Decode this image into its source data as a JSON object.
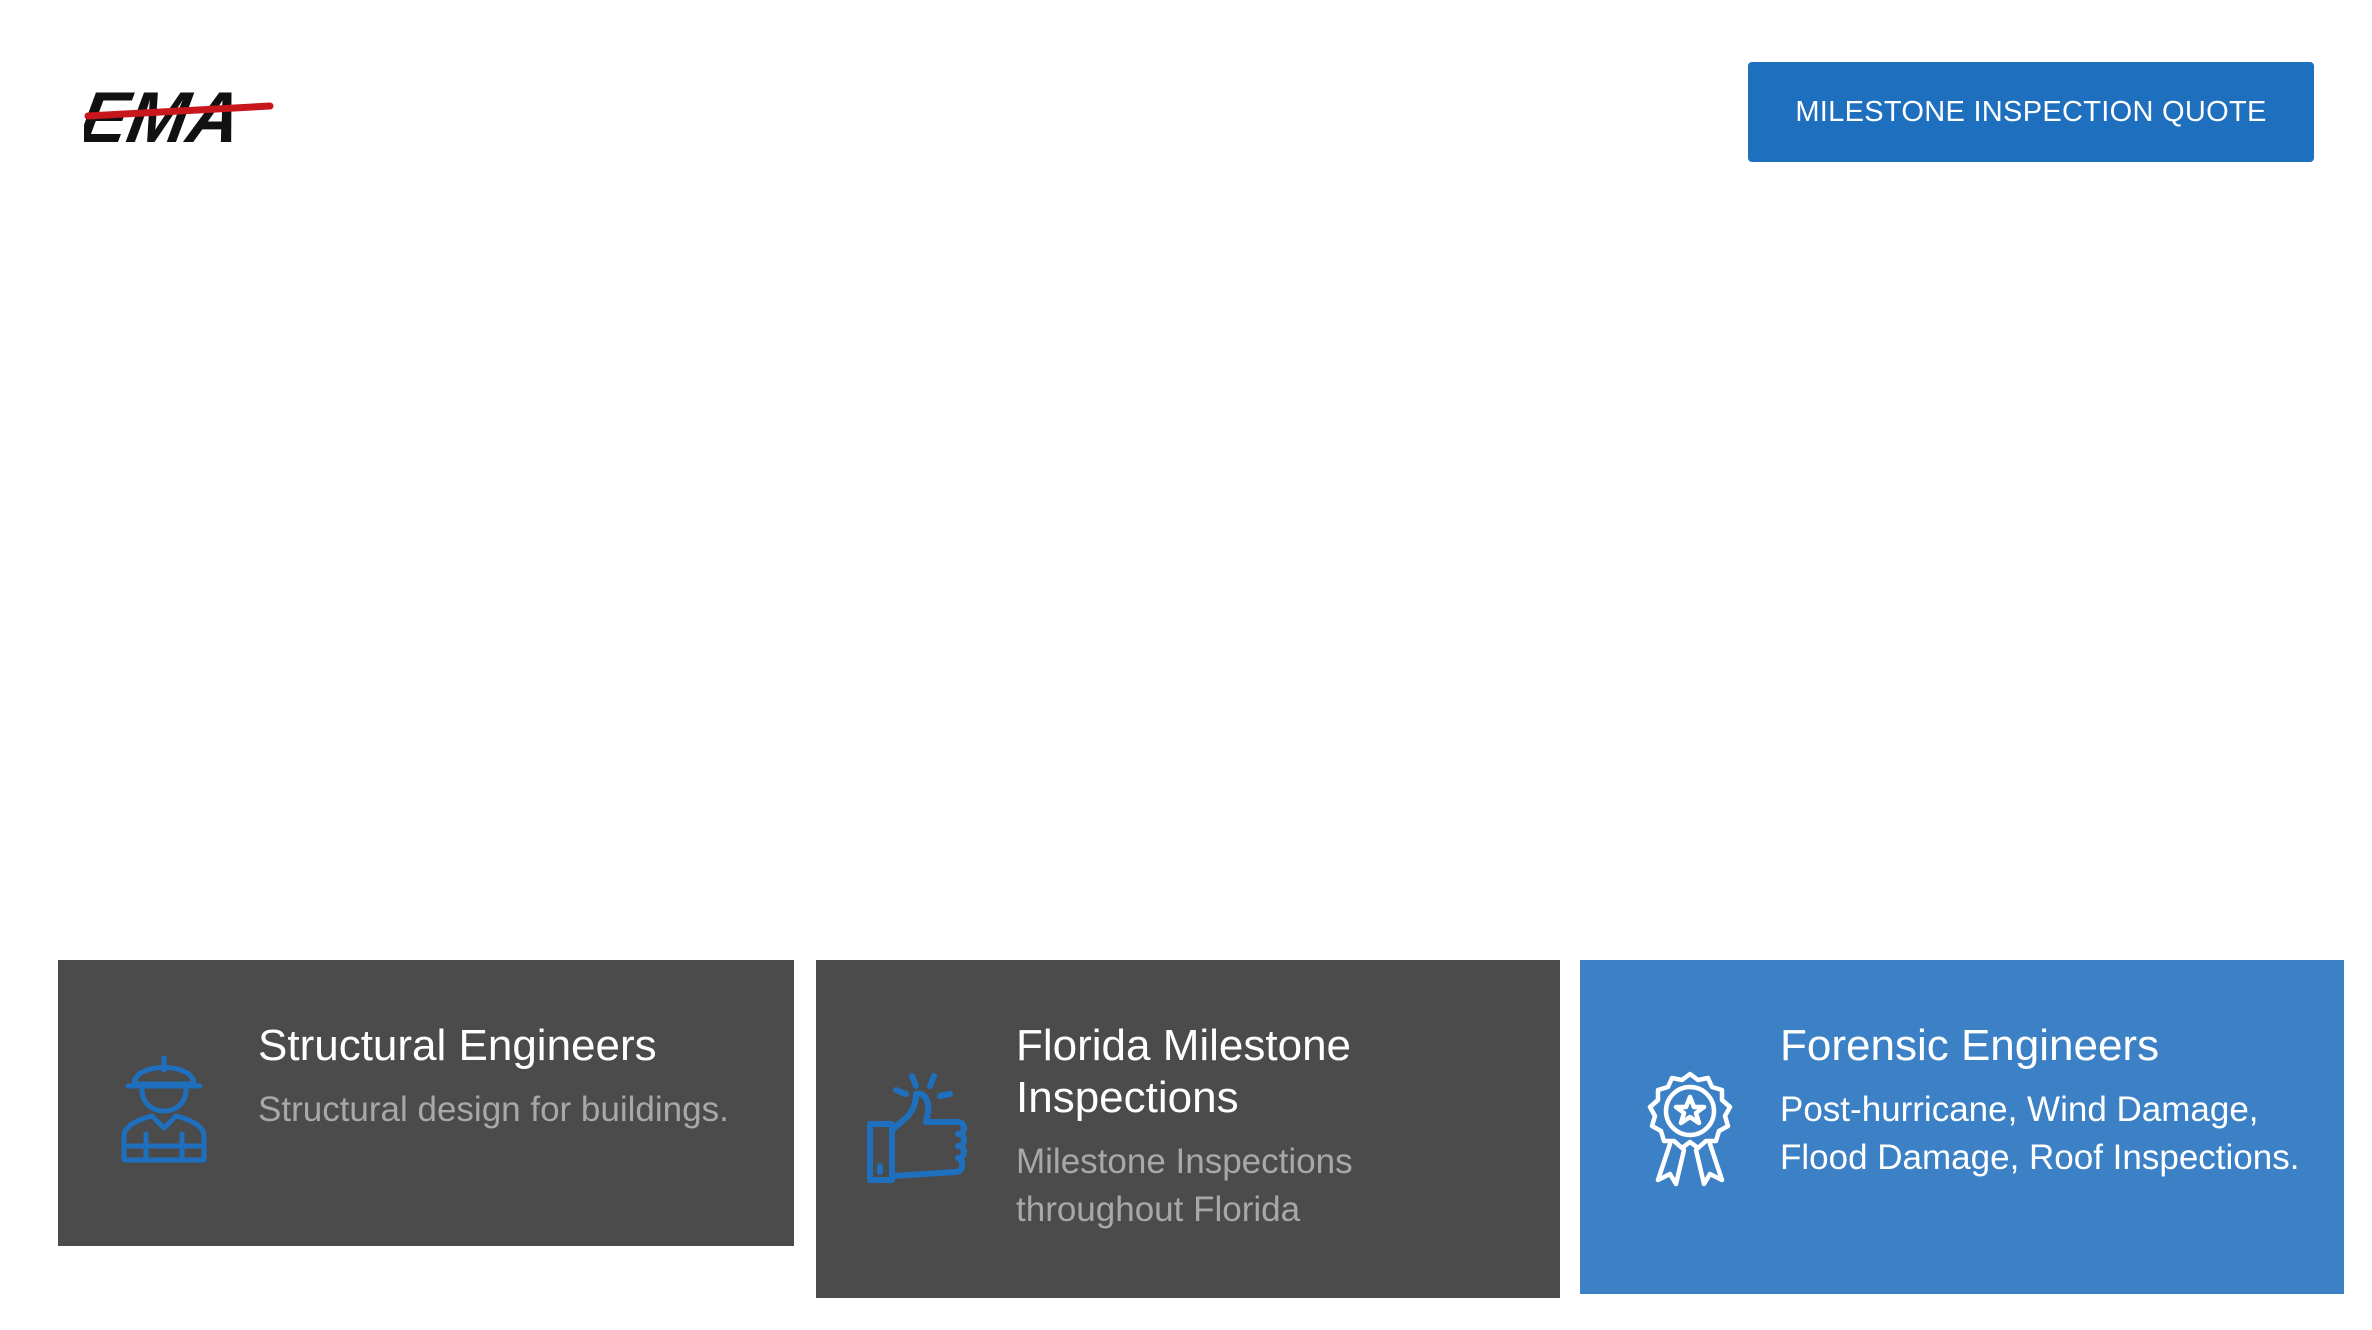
{
  "header": {
    "logo_text": "EMA",
    "cta_label": "MILESTONE INSPECTION QUOTE"
  },
  "cards": [
    {
      "title": "Structural Engineers",
      "description": "Structural design for buildings.",
      "icon": "engineer-hardhat-icon"
    },
    {
      "title": "Florida Milestone Inspections",
      "description": "Milestone Inspections throughout Florida",
      "icon": "thumbs-up-icon"
    },
    {
      "title": "Forensic Engineers",
      "description": "Post-hurricane, Wind Damage, Flood Damage, Roof Inspections.",
      "icon": "award-ribbon-icon"
    }
  ],
  "colors": {
    "primary_blue": "#1f6fbf",
    "card_dark": "#4b4b4b",
    "card_blue": "#3c81c6",
    "icon_blue": "#1f6fbf",
    "logo_red": "#c8161d"
  }
}
